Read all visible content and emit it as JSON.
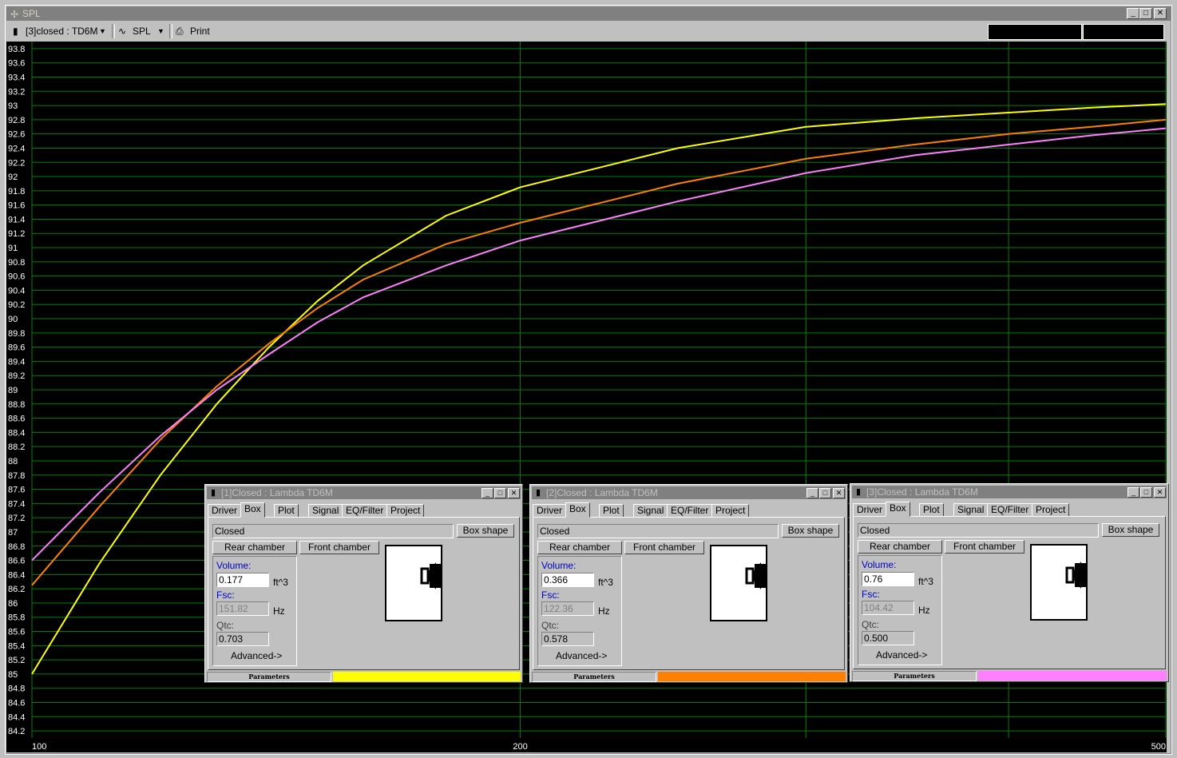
{
  "window": {
    "title": "SPL"
  },
  "toolbar": {
    "project_select": "[3]closed : TD6M",
    "plot_select": "SPL",
    "print_label": "Print"
  },
  "chart_data": {
    "type": "line",
    "title": "",
    "xlabel": "",
    "ylabel": "",
    "x_scale": "log",
    "xlim": [
      100,
      500
    ],
    "ylim": [
      84.1,
      93.9
    ],
    "x_ticks": [
      "100",
      "200",
      "500"
    ],
    "y_ticks": [
      "93.8",
      "93.6",
      "93.4",
      "93.2",
      "93",
      "92.8",
      "92.6",
      "92.4",
      "92.2",
      "92",
      "91.8",
      "91.6",
      "91.4",
      "91.2",
      "91",
      "90.8",
      "90.6",
      "90.4",
      "90.2",
      "90",
      "89.8",
      "89.6",
      "89.4",
      "89.2",
      "89",
      "88.8",
      "88.6",
      "88.4",
      "88.2",
      "88",
      "87.8",
      "87.6",
      "87.4",
      "87.2",
      "87",
      "86.8",
      "86.6",
      "86.4",
      "86.2",
      "86",
      "85.8",
      "85.6",
      "85.4",
      "85.2",
      "85",
      "84.8",
      "84.6",
      "84.4",
      "84.2"
    ],
    "grid": true,
    "background": "#000000",
    "grid_color": "#008000",
    "series": [
      {
        "color": "#ffff00",
        "x": [
          100,
          110,
          120,
          130,
          140,
          150,
          160,
          180,
          200,
          250,
          300,
          350,
          400,
          450,
          500
        ],
        "values": [
          85.0,
          86.55,
          87.8,
          88.8,
          89.6,
          90.25,
          90.75,
          91.45,
          91.85,
          92.4,
          92.7,
          92.82,
          92.9,
          92.97,
          93.02
        ]
      },
      {
        "color": "#ff8000",
        "x": [
          100,
          110,
          120,
          130,
          140,
          150,
          160,
          180,
          200,
          250,
          300,
          350,
          400,
          450,
          500
        ],
        "values": [
          86.25,
          87.35,
          88.3,
          89.05,
          89.65,
          90.15,
          90.55,
          91.05,
          91.35,
          91.9,
          92.25,
          92.45,
          92.6,
          92.7,
          92.8
        ]
      },
      {
        "color": "#ff80ff",
        "x": [
          100,
          110,
          120,
          130,
          140,
          150,
          160,
          180,
          200,
          250,
          300,
          350,
          400,
          450,
          500
        ],
        "values": [
          86.6,
          87.55,
          88.35,
          89.0,
          89.5,
          89.95,
          90.3,
          90.75,
          91.1,
          91.65,
          92.05,
          92.3,
          92.45,
          92.58,
          92.68
        ]
      }
    ]
  },
  "panels": [
    {
      "title": "[1]Closed : Lambda TD6M",
      "tabs": [
        "Driver",
        "Box",
        "Plot",
        "Signal",
        "EQ/Filter",
        "Project"
      ],
      "box_type": "Closed",
      "box_shape_label": "Box shape",
      "rear_label": "Rear chamber",
      "front_label": "Front chamber",
      "volume_label": "Volume:",
      "volume_value": "0.177",
      "volume_unit": "ft^3",
      "fsc_label": "Fsc:",
      "fsc_value": "151.82",
      "fsc_unit": "Hz",
      "qtc_label": "Qtc:",
      "qtc_value": "0.703",
      "advanced_label": "Advanced->",
      "status_label": "Parameters",
      "color": "#ffff00"
    },
    {
      "title": "[2]Closed : Lambda TD6M",
      "tabs": [
        "Driver",
        "Box",
        "Plot",
        "Signal",
        "EQ/Filter",
        "Project"
      ],
      "box_type": "Closed",
      "box_shape_label": "Box shape",
      "rear_label": "Rear chamber",
      "front_label": "Front chamber",
      "volume_label": "Volume:",
      "volume_value": "0.366",
      "volume_unit": "ft^3",
      "fsc_label": "Fsc:",
      "fsc_value": "122.36",
      "fsc_unit": "Hz",
      "qtc_label": "Qtc:",
      "qtc_value": "0.578",
      "advanced_label": "Advanced->",
      "status_label": "Parameters",
      "color": "#ff8000"
    },
    {
      "title": "[3]Closed : Lambda TD6M",
      "tabs": [
        "Driver",
        "Box",
        "Plot",
        "Signal",
        "EQ/Filter",
        "Project"
      ],
      "box_type": "Closed",
      "box_shape_label": "Box shape",
      "rear_label": "Rear chamber",
      "front_label": "Front chamber",
      "volume_label": "Volume:",
      "volume_value": "0.76",
      "volume_unit": "ft^3",
      "fsc_label": "Fsc:",
      "fsc_value": "104.42",
      "fsc_unit": "Hz",
      "qtc_label": "Qtc:",
      "qtc_value": "0.500",
      "advanced_label": "Advanced->",
      "status_label": "Parameters",
      "color": "#ff80ff"
    }
  ]
}
